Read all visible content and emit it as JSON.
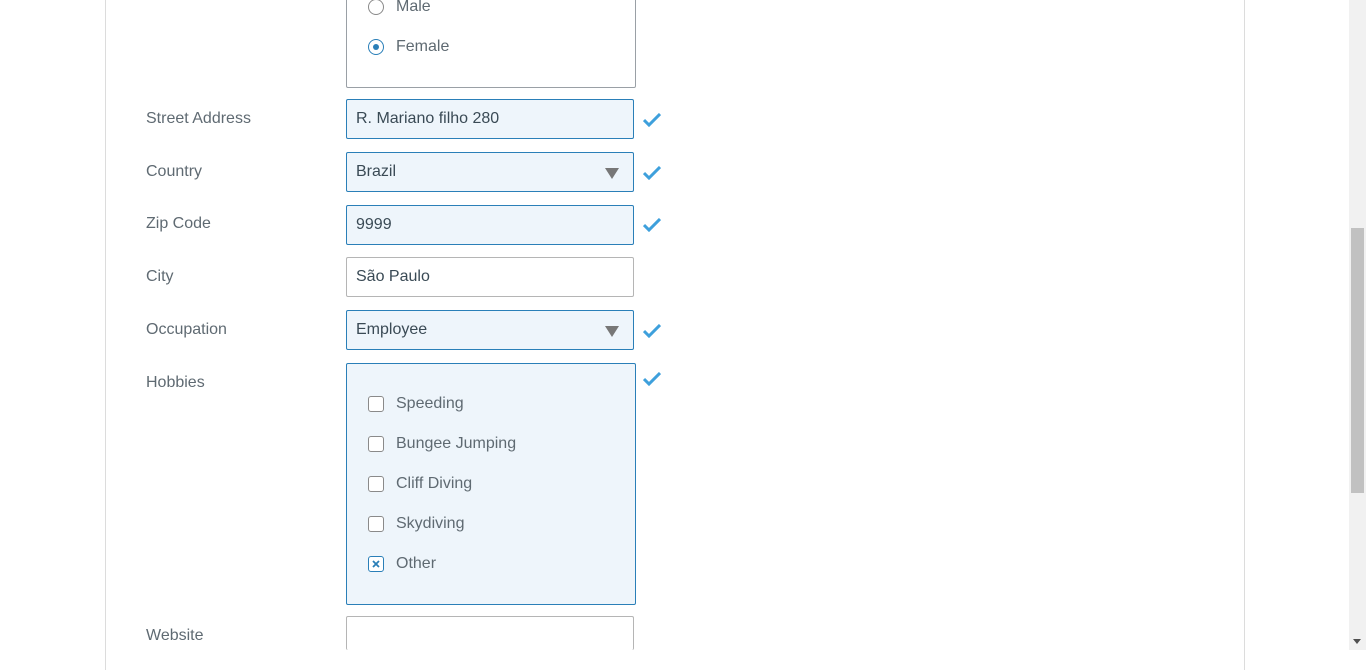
{
  "gender": {
    "options": [
      {
        "label": "Male",
        "checked": false
      },
      {
        "label": "Female",
        "checked": true
      }
    ]
  },
  "fields": {
    "street": {
      "label": "Street Address",
      "value": "R. Mariano filho 280"
    },
    "country": {
      "label": "Country",
      "value": "Brazil"
    },
    "zip": {
      "label": "Zip Code",
      "value": "9999"
    },
    "city": {
      "label": "City",
      "value": "São Paulo"
    },
    "occupation": {
      "label": "Occupation",
      "value": "Employee"
    },
    "hobbies": {
      "label": "Hobbies"
    },
    "website": {
      "label": "Website",
      "value": ""
    }
  },
  "hobbies": [
    {
      "label": "Speeding",
      "checked": false
    },
    {
      "label": "Bungee Jumping",
      "checked": false
    },
    {
      "label": "Cliff Diving",
      "checked": false
    },
    {
      "label": "Skydiving",
      "checked": false
    },
    {
      "label": "Other",
      "checked": true
    }
  ],
  "colors": {
    "accent": "#2a7fb8",
    "valid_bg": "#eef5fb",
    "check_mark": "#3ea0dc"
  },
  "icons": {
    "valid": "checkmark-icon",
    "dropdown": "caret-down-icon"
  }
}
